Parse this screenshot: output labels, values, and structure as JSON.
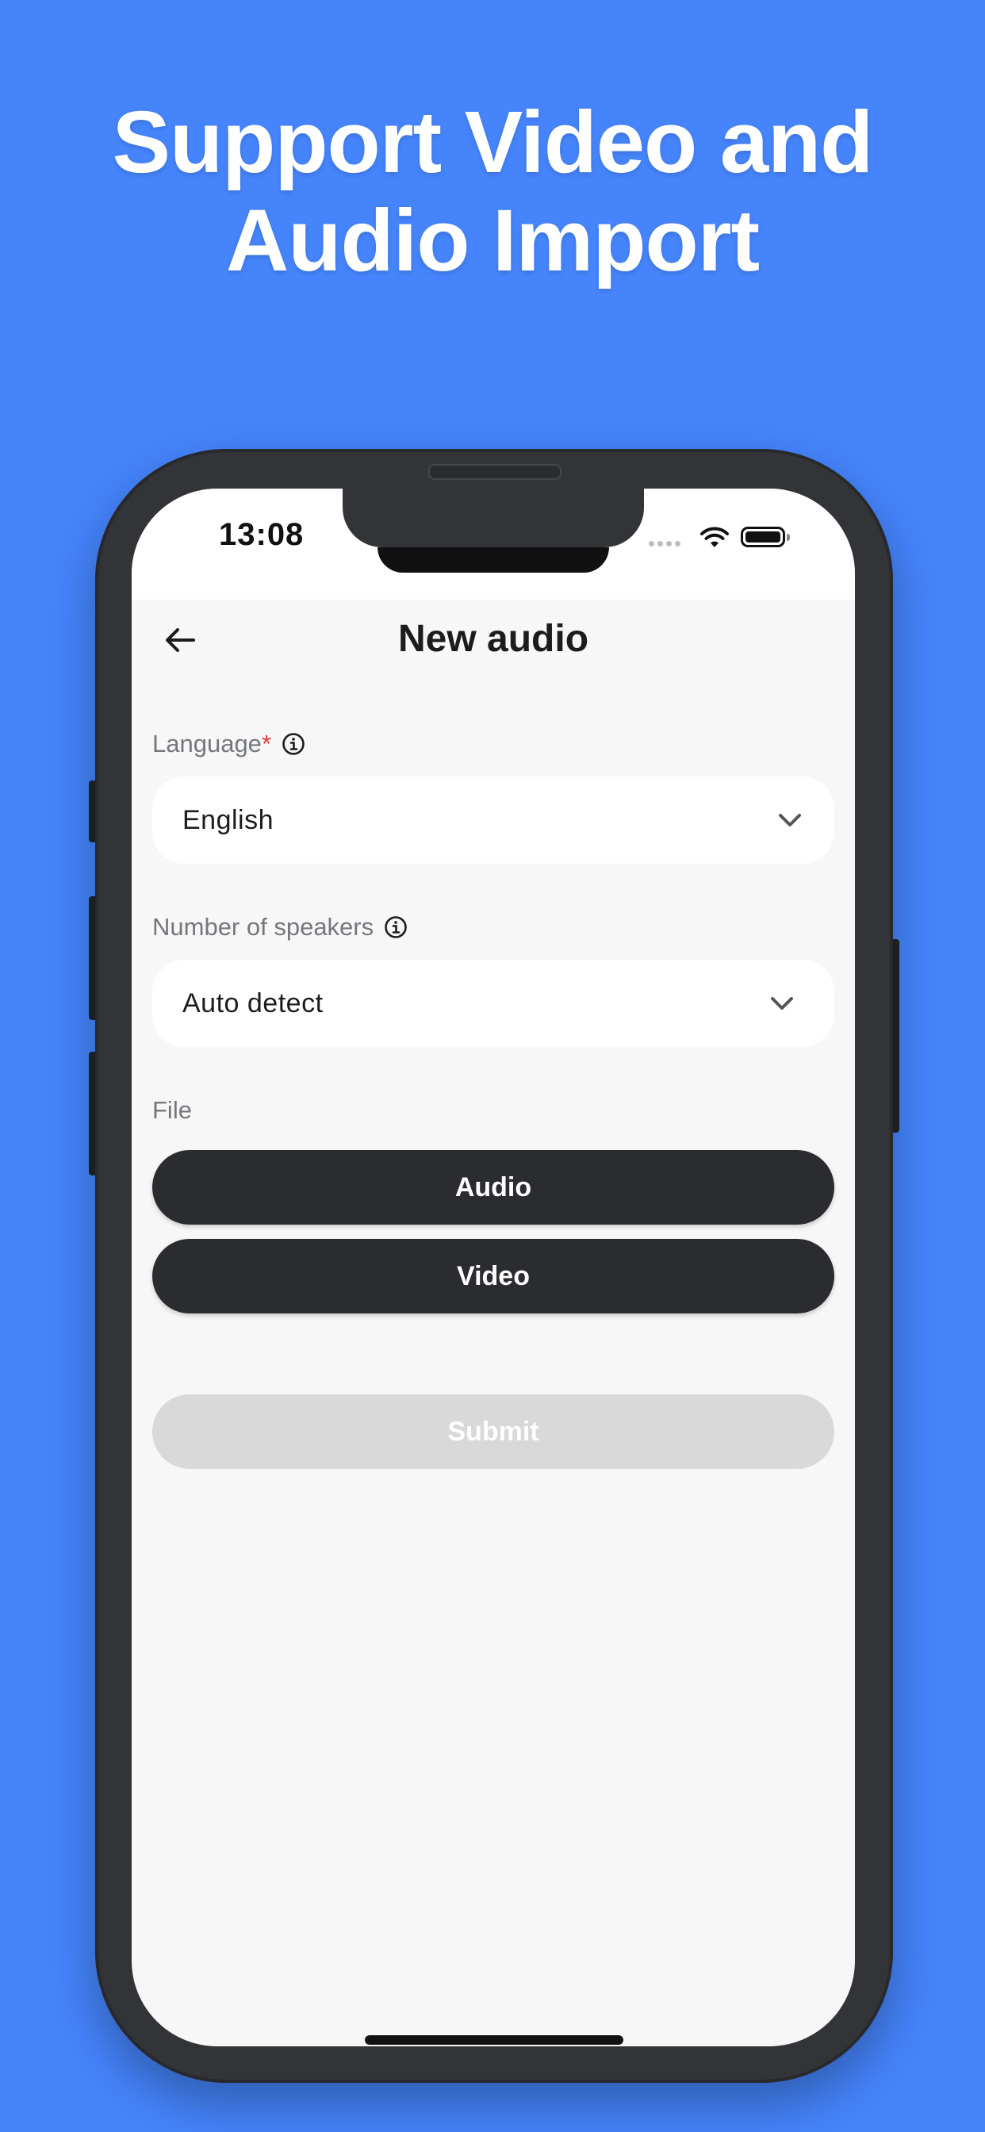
{
  "headline": {
    "line1": "Support Video and",
    "line2": "Audio Import"
  },
  "status_bar": {
    "time": "13:08",
    "icons": [
      "signal-dots-icon",
      "wifi-icon",
      "battery-icon"
    ]
  },
  "nav": {
    "back_icon": "arrow-left-icon",
    "title": "New audio"
  },
  "form": {
    "language": {
      "label": "Language",
      "required_mark": "*",
      "info_icon": "info-circle-icon",
      "value": "English"
    },
    "speakers": {
      "label": "Number of speakers",
      "info_icon": "info-circle-icon",
      "value": "Auto detect"
    },
    "file": {
      "label": "File",
      "audio_button": "Audio",
      "video_button": "Video"
    },
    "submit_label": "Submit"
  },
  "colors": {
    "background": "#4584fb",
    "screen": "#f7f7f7",
    "dark_button": "#2b2c30",
    "disabled_button": "#d9d9d9",
    "required": "#e53935"
  }
}
